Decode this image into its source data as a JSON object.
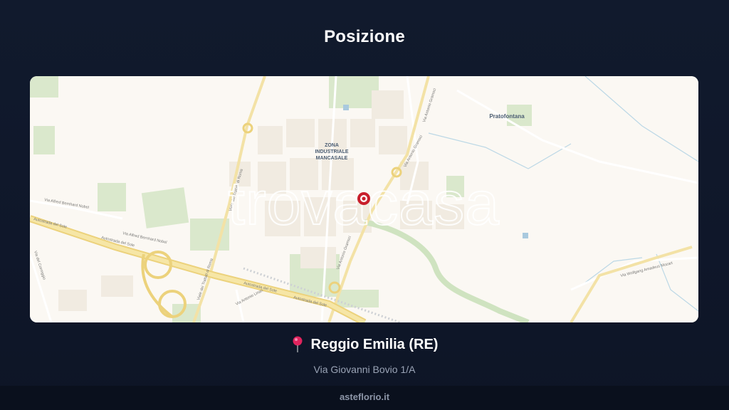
{
  "header": {
    "title": "Posizione"
  },
  "map": {
    "place_labels": {
      "zona": [
        "ZONA",
        "INDUSTRIALE",
        "MANCASALE"
      ],
      "pratofontana": "Pratofontana"
    },
    "road_labels": {
      "alfred_nobel_1": "Via Alfred Bernhard Nobel",
      "alfred_nobel_2": "Via Alfred Bernhard Nobel",
      "autostrada_1": "Autostrada del Sole",
      "autostrada_2": "Autostrada del Sole",
      "autostrada_3": "Autostrada del Sole",
      "autostrada_4": "Autostrada del Sole",
      "trattati_1": "Viale dei Trattati di Roma",
      "trattati_2": "Viale dei Trattati di Roma",
      "gramsci_1": "Via Antonio Gramsci",
      "gramsci_2": "Via Antonio Gramsci",
      "gramsci_3": "Via Antonio Gramsci",
      "correggio": "Via del Correggio",
      "mozart": "Via Wolfgang Amadeus Mozart",
      "linari": "Via Antonio Linari"
    },
    "watermark": "trovacasa",
    "marker": {
      "name": "location-marker",
      "color": "#c81e2b"
    }
  },
  "location": {
    "icon": "pin-icon",
    "city": "Reggio Emilia (RE)",
    "address": "Via Giovanni Bovio 1/A"
  },
  "footer": {
    "site": "asteflorio.it"
  },
  "colors": {
    "background": "#0f172a",
    "map_base": "#fbf8f3",
    "green_area": "#cfe3c0",
    "highway": "#f0d98a",
    "water": "#bcd8e6"
  }
}
